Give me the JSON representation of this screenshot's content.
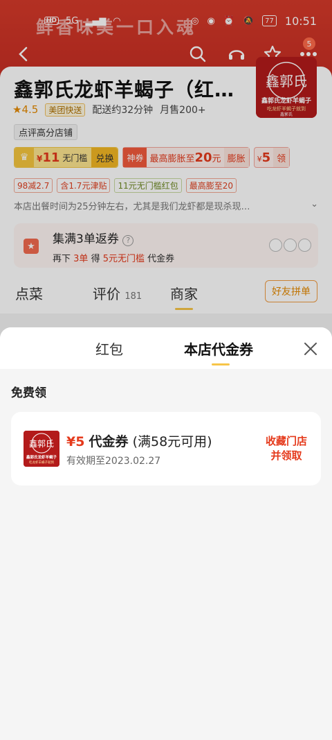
{
  "status_bar": {
    "left_badge": "HD",
    "network": "5G",
    "battery": "77",
    "time": "10:51"
  },
  "hero": {
    "slogan": "鲜香味美一口入魂"
  },
  "nav": {
    "notification_count": "5"
  },
  "shop": {
    "name": "鑫郭氏龙虾羊蝎子（红…",
    "logo_brand": "鑫郭氏",
    "logo_title": "鑫郭氏龙虾羊蝎子",
    "logo_slogan": "吃龙虾羊蝎子就到",
    "logo_footer": "鑫郭氏",
    "rating": "★4.5",
    "delivery_tag": "美团快送",
    "delivery_time": "配送约32分钟",
    "monthly_sales": "月售200+",
    "rank_tag": "点评高分店铺"
  },
  "coupons": {
    "gold_currency": "¥",
    "gold_amount": "11",
    "gold_label": "无门槛",
    "gold_action": "兑换",
    "god_label": "神券",
    "god_text_prefix": "最高膨胀至",
    "god_amount": "20",
    "god_text_suffix": "元",
    "god_action": "膨胀",
    "small_currency": "¥",
    "small_amount": "5",
    "small_extra": "领"
  },
  "promos": [
    "98减2.7",
    "含1.7元津贴",
    "11元无门槛红包",
    "最高膨至20"
  ],
  "notice": "本店出餐时间为25分钟左右，尤其是我们龙虾都是现杀现…",
  "collect": {
    "title": "集满3单返券",
    "help_icon": "?",
    "sub_prefix": "再下",
    "sub_count": "3单",
    "sub_mid": "得",
    "sub_reward": "5元无门槛",
    "sub_suffix": "代金券"
  },
  "page_tabs": {
    "order": "点菜",
    "reviews": "评价",
    "reviews_count": "181",
    "merchant": "商家",
    "group_order": "好友拼单"
  },
  "sheet": {
    "tab_red_packet": "红包",
    "tab_store_voucher": "本店代金券",
    "section_title": "免费领",
    "voucher": {
      "amount": "¥5",
      "type": "代金券",
      "condition": "(满58元可用)",
      "expiry": "有效期至2023.02.27",
      "action_line1": "收藏门店",
      "action_line2": "并领取"
    }
  },
  "colors": {
    "accent_red": "#e53a1c",
    "tab_underline": "#f7c548",
    "hero_red": "#c32b22"
  }
}
